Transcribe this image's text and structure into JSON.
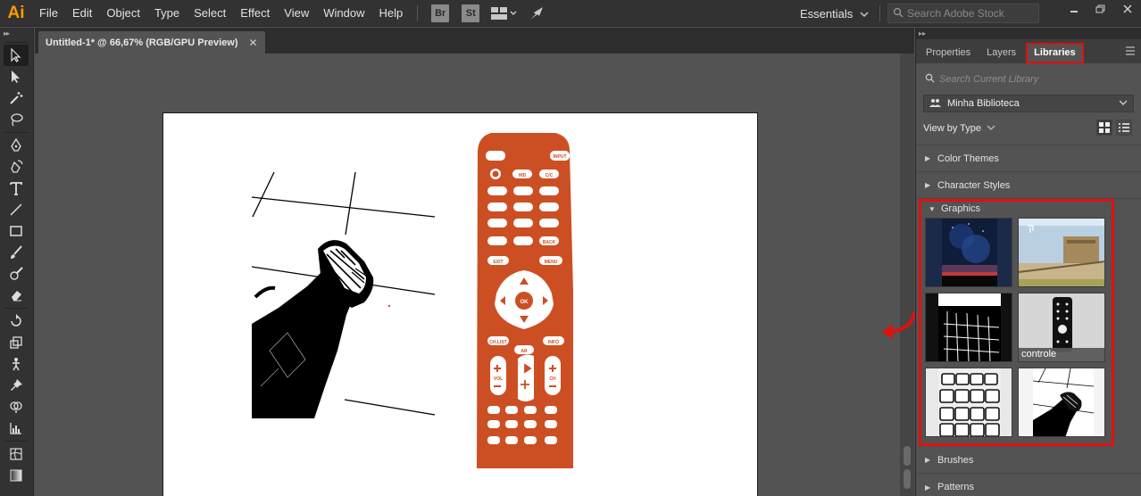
{
  "app": {
    "logo": "Ai",
    "workspace": "Essentials",
    "stock_placeholder": "Search Adobe Stock"
  },
  "menu": [
    "File",
    "Edit",
    "Object",
    "Type",
    "Select",
    "Effect",
    "View",
    "Window",
    "Help"
  ],
  "bridge_buttons": [
    "Br",
    "St"
  ],
  "document": {
    "tab_title": "Untitled-1* @ 66,67% (RGB/GPU Preview)"
  },
  "tools": [
    "selection-tool",
    "direct-selection-tool",
    "magic-wand-tool",
    "lasso-tool",
    "pen-tool",
    "curvature-tool",
    "type-tool",
    "line-tool",
    "rectangle-tool",
    "paintbrush-tool",
    "blob-brush-tool",
    "eraser-tool",
    "rotate-tool",
    "scale-tool",
    "puppet-warp-tool",
    "pin-tool",
    "shape-builder-tool",
    "graph-tool",
    "mesh-tool",
    "gradient-tool"
  ],
  "panel": {
    "tabs": [
      "Properties",
      "Layers",
      "Libraries"
    ],
    "active_tab": "Libraries",
    "search_placeholder": "Search Current Library",
    "library_name": "Minha Biblioteca",
    "view_by": "View by Type",
    "sections": {
      "color_themes": "Color Themes",
      "character_styles": "Character Styles",
      "graphics": "Graphics",
      "brushes": "Brushes",
      "patterns": "Patterns"
    },
    "thumb_label": "controle"
  },
  "remote_labels": {
    "input": "INPUT",
    "hid": "HID",
    "cc": "C/C",
    "back": "BACK",
    "exit": "EXIT",
    "menu": "MENU",
    "ok": "OK",
    "chlist": "CH.LIST",
    "ar": "AR",
    "info": "INFO",
    "vol": "VOL",
    "ch": "CH"
  },
  "accent_colors": {
    "highlight_red": "#e01010",
    "remote_orange": "#cc4f24",
    "ai_orange": "#ff9a00"
  }
}
